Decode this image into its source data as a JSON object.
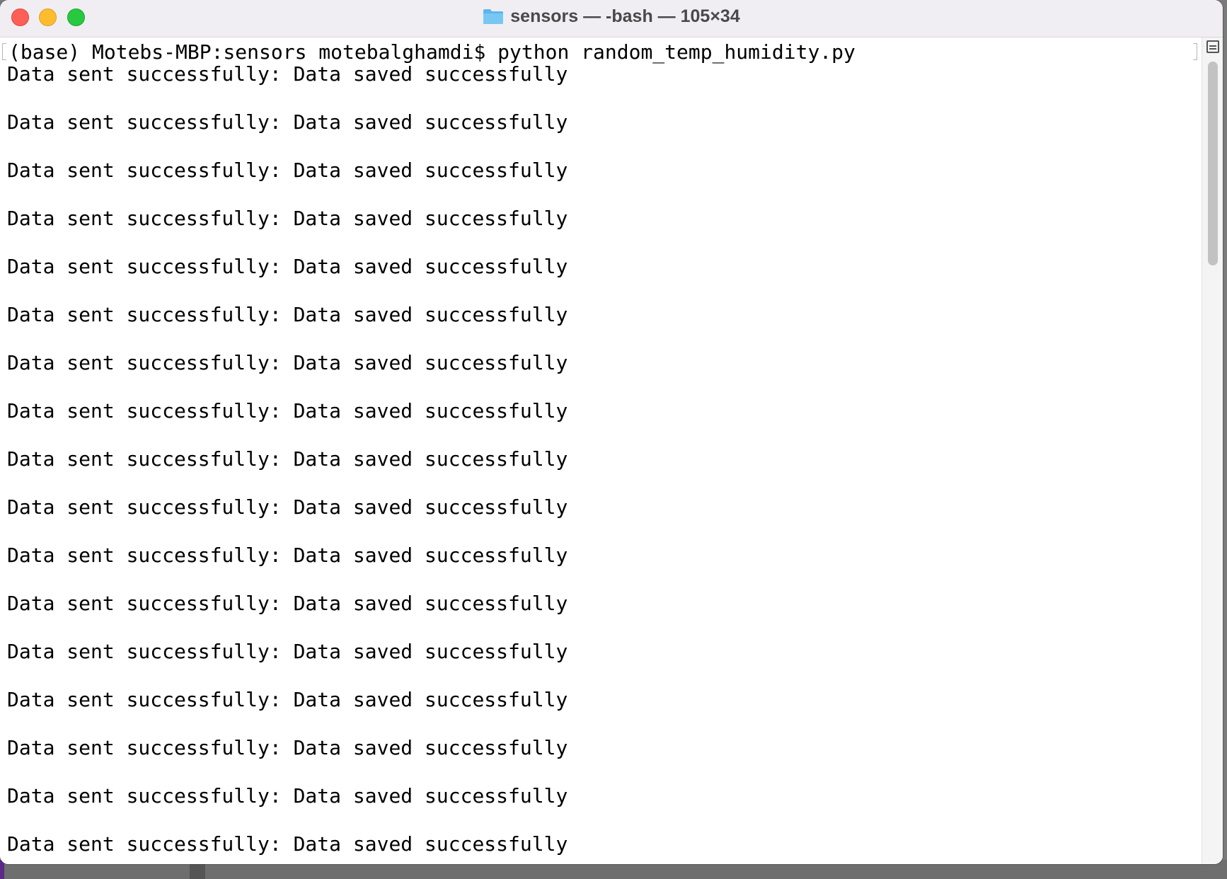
{
  "window": {
    "title": "sensors — -bash — 105×34",
    "title_icon": "folder-icon",
    "controls": {
      "close_color": "#fe5f57",
      "minimize_color": "#febc2e",
      "maximize_color": "#28c840"
    }
  },
  "terminal": {
    "prompt": "(base) Motebs-MBP:sensors motebalghamdi$ python random_temp_humidity.py",
    "output": [
      "Data sent successfully: Data saved successfully",
      "Data sent successfully: Data saved successfully",
      "Data sent successfully: Data saved successfully",
      "Data sent successfully: Data saved successfully",
      "Data sent successfully: Data saved successfully",
      "Data sent successfully: Data saved successfully",
      "Data sent successfully: Data saved successfully",
      "Data sent successfully: Data saved successfully",
      "Data sent successfully: Data saved successfully",
      "Data sent successfully: Data saved successfully",
      "Data sent successfully: Data saved successfully",
      "Data sent successfully: Data saved successfully",
      "Data sent successfully: Data saved successfully",
      "Data sent successfully: Data saved successfully",
      "Data sent successfully: Data saved successfully",
      "Data sent successfully: Data saved successfully",
      "Data sent successfully: Data saved successfully"
    ]
  },
  "scrollbar": {
    "split_icon": "split-pane-icon"
  }
}
